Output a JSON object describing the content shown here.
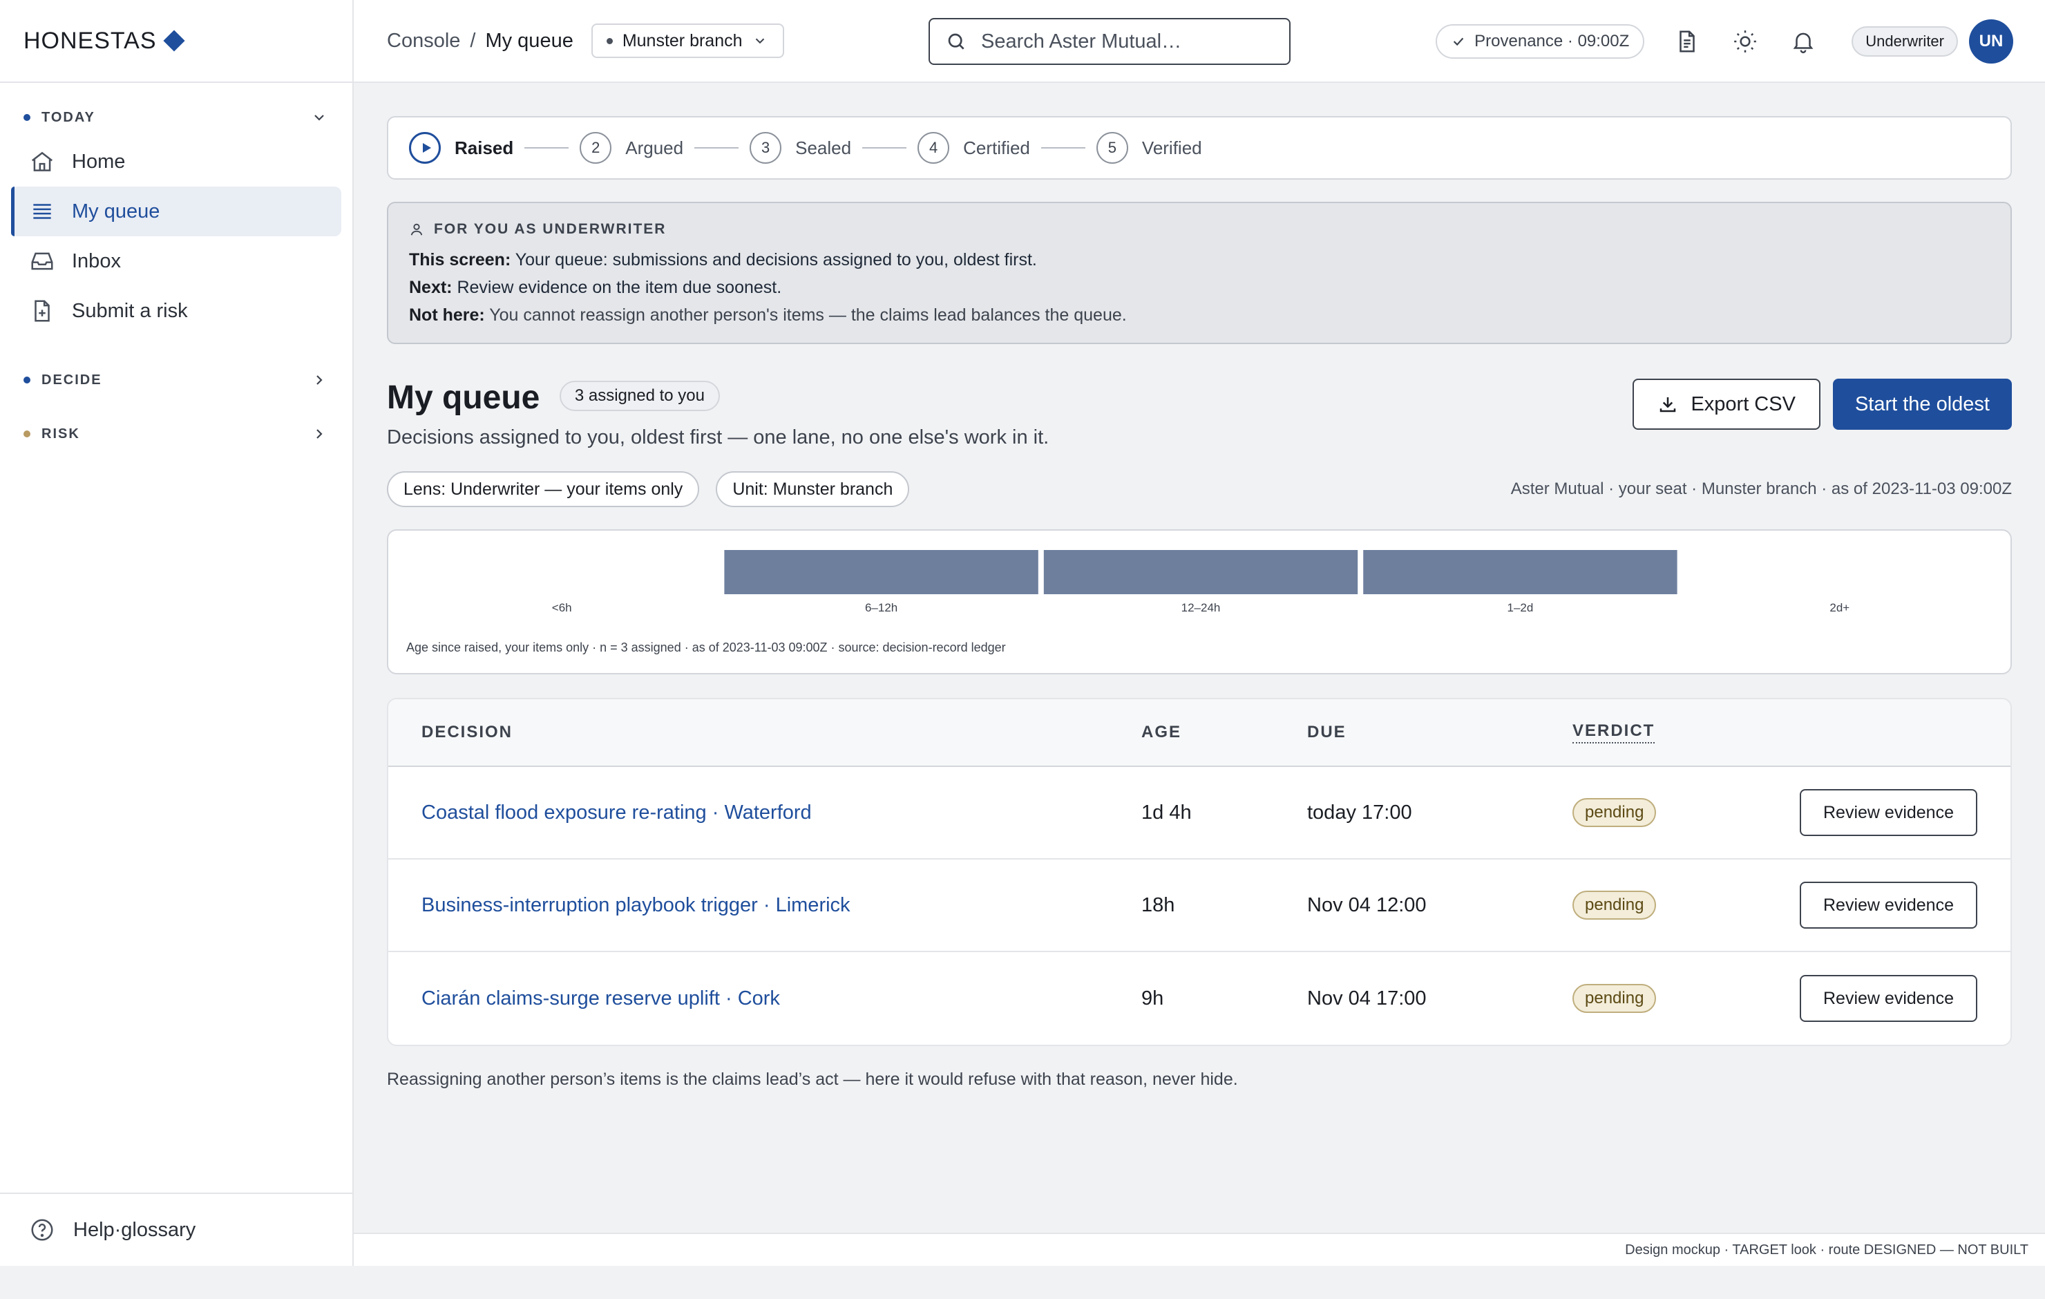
{
  "brand": {
    "name": "HONESTAS"
  },
  "sidebar": {
    "sections": [
      {
        "label": "TODAY"
      },
      {
        "label": "DECIDE"
      },
      {
        "label": "RISK"
      }
    ],
    "items": [
      {
        "label": "Home",
        "icon": "home-icon"
      },
      {
        "label": "My queue",
        "icon": "list-icon",
        "active": true
      },
      {
        "label": "Inbox",
        "icon": "inbox-icon"
      },
      {
        "label": "Submit a risk",
        "icon": "file-plus-icon"
      }
    ],
    "footer": {
      "label": "Help·glossary",
      "icon": "help-circle-icon"
    }
  },
  "header": {
    "breadcrumb_root": "Console",
    "breadcrumb_sep": "/",
    "breadcrumb_current": "My queue",
    "branch": "Munster branch",
    "search_placeholder": "Search Aster Mutual…",
    "provenance": "Provenance · 09:00Z",
    "role": "Underwriter",
    "avatar_initials": "UN"
  },
  "stepper": {
    "steps": [
      {
        "num": "",
        "label": "Raised",
        "active": true
      },
      {
        "num": "2",
        "label": "Argued"
      },
      {
        "num": "3",
        "label": "Sealed"
      },
      {
        "num": "4",
        "label": "Certified"
      },
      {
        "num": "5",
        "label": "Verified"
      }
    ]
  },
  "info": {
    "heading": "FOR YOU AS UNDERWRITER",
    "lines": [
      {
        "key": "This screen:",
        "text": " Your queue: submissions and decisions assigned to you, oldest first."
      },
      {
        "key": "Next:",
        "text": " Review evidence on the item due soonest."
      },
      {
        "key": "Not here:",
        "text": " You cannot reassign another person's items — the claims lead balances the queue."
      }
    ]
  },
  "page": {
    "title": "My queue",
    "count": "3 assigned to you",
    "subtitle": "Decisions assigned to you, oldest first — one lane, no one else's work in it.",
    "export_label": "Export CSV",
    "start_label": "Start the oldest",
    "chips": [
      "Lens: Underwriter — your items only",
      "Unit: Munster branch"
    ],
    "meta": "Aster Mutual · your seat · Munster branch · as of 2023-11-03 09:00Z",
    "footnote": "Reassigning another person’s items is the claims lead’s act — here it would refuse with that reason, never hide."
  },
  "chart_data": {
    "type": "bar",
    "categories": [
      "<6h",
      "6–12h",
      "12–24h",
      "1–2d",
      "2d+"
    ],
    "values": [
      0,
      1,
      1,
      1,
      0
    ],
    "caption": "Age since raised, your items only · n = 3 assigned · as of 2023-11-03 09:00Z · source: decision-record ledger",
    "bar_color": "#6e7f9e"
  },
  "table": {
    "headers": [
      "DECISION",
      "AGE",
      "DUE",
      "VERDICT"
    ],
    "rows": [
      {
        "decision": "Coastal flood exposure re-rating · Waterford",
        "age": "1d 4h",
        "due": "today 17:00",
        "verdict": "pending",
        "action": "Review evidence"
      },
      {
        "decision": "Business-interruption playbook trigger · Limerick",
        "age": "18h",
        "due": "Nov 04 12:00",
        "verdict": "pending",
        "action": "Review evidence"
      },
      {
        "decision": "Ciarán claims-surge reserve uplift · Cork",
        "age": "9h",
        "due": "Nov 04 17:00",
        "verdict": "pending",
        "action": "Review evidence"
      }
    ]
  },
  "footer": {
    "text": "Design mockup · TARGET look · route DESIGNED — NOT BUILT"
  },
  "colors": {
    "accent": "#1f4e9c",
    "pending_bg": "#f3edda"
  }
}
